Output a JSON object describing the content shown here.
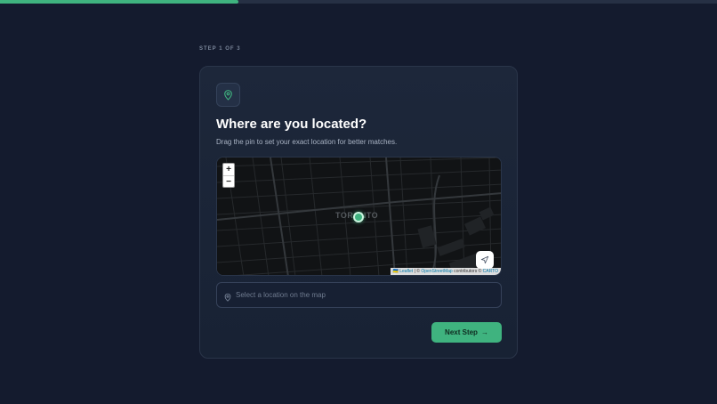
{
  "progress": {
    "fraction": 0.333
  },
  "step_label": "STEP 1 OF 3",
  "card": {
    "title": "Where are you located?",
    "subtitle": "Drag the pin to set your exact location for better matches."
  },
  "map": {
    "zoom_in": "+",
    "zoom_out": "−",
    "city_label": "TORONTO",
    "attribution": {
      "flag": "🇺🇦",
      "leaflet": "Leaflet",
      "separator": "|",
      "copyright_osm": "©",
      "osm": "OpenStreetMap",
      "contributors": "contributors ©",
      "carto": "CARTO"
    }
  },
  "location_input": {
    "placeholder": "Select a location on the map",
    "value": ""
  },
  "next_button": {
    "label": "Next Step",
    "arrow": "→"
  },
  "colors": {
    "accent": "#3fb37f",
    "background": "#141b2e",
    "card": "#1d273a"
  }
}
